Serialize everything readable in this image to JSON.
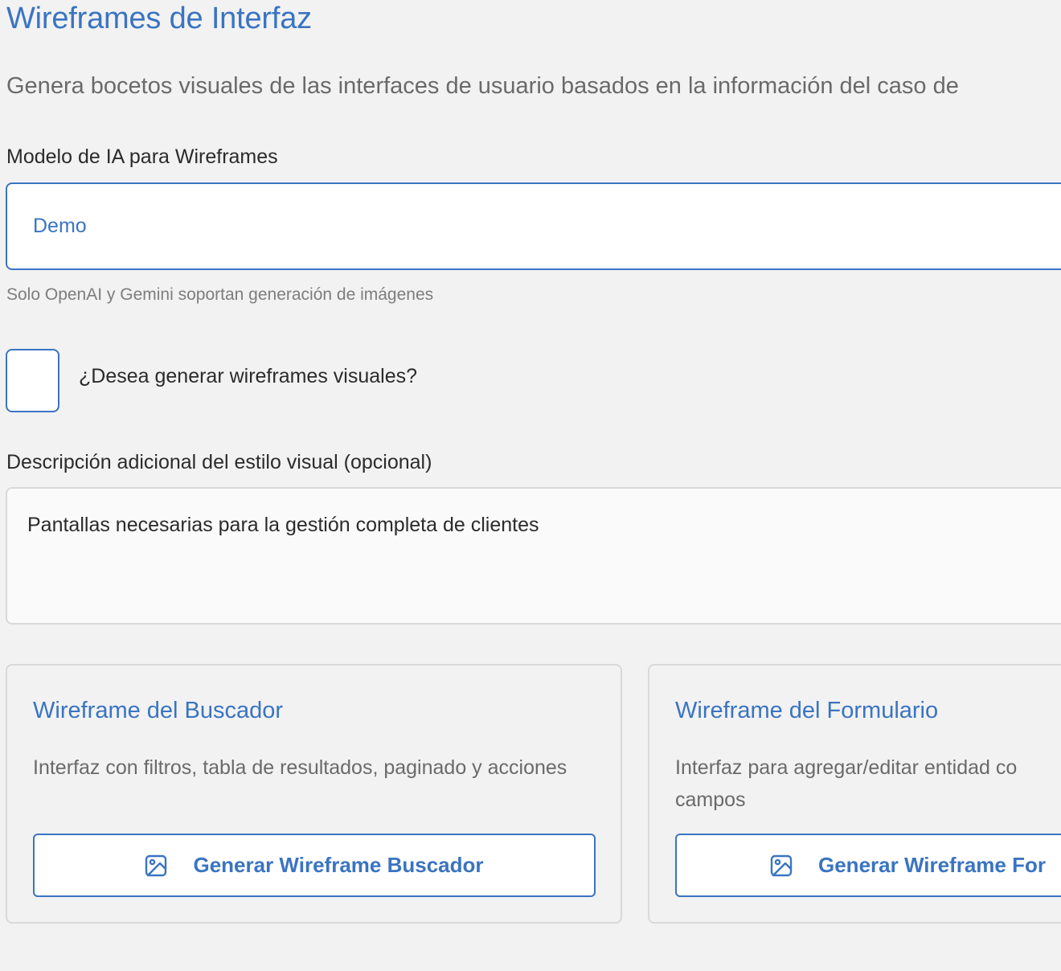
{
  "page": {
    "title": "Wireframes de Interfaz",
    "description": "Genera bocetos visuales de las interfaces de usuario basados en la información del caso de"
  },
  "model_field": {
    "label": "Modelo de IA para Wireframes",
    "value": "Demo",
    "helper": "Solo OpenAI y Gemini soportan generación de imágenes"
  },
  "visual_checkbox": {
    "label": "¿Desea generar wireframes visuales?",
    "checked": false
  },
  "style_field": {
    "label": "Descripción adicional del estilo visual (opcional)",
    "value": "Pantallas necesarias para la gestión completa de clientes"
  },
  "cards": [
    {
      "title": "Wireframe del Buscador",
      "description": "Interfaz con filtros, tabla de resultados, paginado y acciones",
      "button_label": "Generar Wireframe Buscador",
      "button_icon": "image-icon"
    },
    {
      "title": "Wireframe del Formulario",
      "description_line1": "Interfaz para agregar/editar entidad co",
      "description_line2": "campos",
      "button_label": "Generar Wireframe For",
      "button_icon": "image-icon"
    }
  ],
  "colors": {
    "accent": "#3a74c2",
    "background": "#f2f2f2",
    "border": "#d9d9d9",
    "muted_text": "#6a6a6a"
  }
}
